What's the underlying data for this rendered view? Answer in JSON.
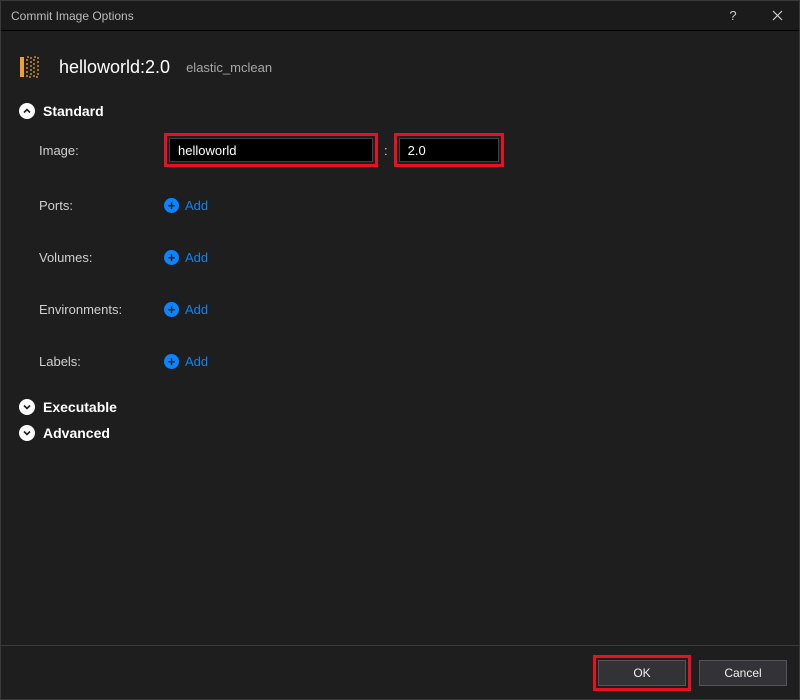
{
  "titlebar": {
    "title": "Commit Image Options"
  },
  "header": {
    "image_with_tag": "helloworld:2.0",
    "container_name": "elastic_mclean"
  },
  "sections": {
    "standard": {
      "title": "Standard",
      "expanded": true
    },
    "executable": {
      "title": "Executable",
      "expanded": false
    },
    "advanced": {
      "title": "Advanced",
      "expanded": false
    }
  },
  "standard_form": {
    "image_label": "Image:",
    "image_name": "helloworld",
    "image_tag": "2.0",
    "ports_label": "Ports:",
    "volumes_label": "Volumes:",
    "environments_label": "Environments:",
    "labels_label": "Labels:",
    "add_text": "Add"
  },
  "footer": {
    "ok": "OK",
    "cancel": "Cancel"
  }
}
